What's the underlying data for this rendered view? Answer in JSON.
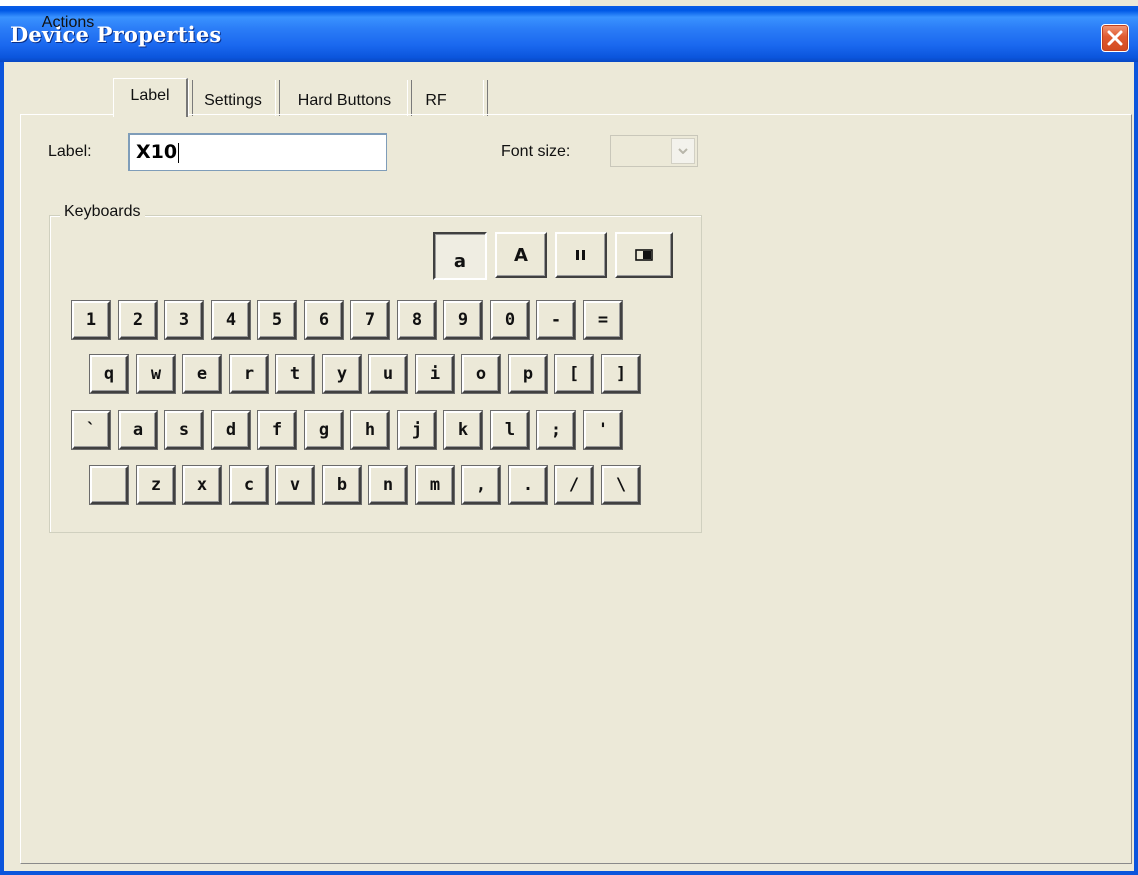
{
  "window": {
    "title": "Device Properties",
    "close_icon": "close-icon"
  },
  "tabs": [
    {
      "label": "Actions",
      "active": false
    },
    {
      "label": "Label",
      "active": true
    },
    {
      "label": "Settings",
      "active": false
    },
    {
      "label": "Hard Buttons",
      "active": false
    },
    {
      "label": "RF",
      "active": false
    }
  ],
  "label_field": {
    "label": "Label:",
    "value": "X10"
  },
  "font_size": {
    "label": "Font size:",
    "value": "",
    "arrow_icon": "chevron-down-icon"
  },
  "keyboards": {
    "title": "Keyboards",
    "modes": [
      {
        "label": "a",
        "name": "lowercase",
        "pressed": true
      },
      {
        "label": "A",
        "name": "uppercase",
        "pressed": false
      },
      {
        "label": "",
        "icon": "pause-icon",
        "name": "symbols",
        "pressed": false
      },
      {
        "label": "",
        "icon": "keypad-icon",
        "name": "special",
        "pressed": false
      }
    ],
    "rows": [
      [
        "1",
        "2",
        "3",
        "4",
        "5",
        "6",
        "7",
        "8",
        "9",
        "0",
        "-",
        "="
      ],
      [
        "q",
        "w",
        "e",
        "r",
        "t",
        "y",
        "u",
        "i",
        "o",
        "p",
        "[",
        "]"
      ],
      [
        "`",
        "a",
        "s",
        "d",
        "f",
        "g",
        "h",
        "j",
        "k",
        "l",
        ";",
        "'"
      ],
      [
        "",
        "z",
        "x",
        "c",
        "v",
        "b",
        "n",
        "m",
        ",",
        ".",
        "/",
        "\\"
      ]
    ]
  },
  "colors": {
    "titlebar": "#0058e6",
    "face": "#ece9d8",
    "close_button": "#e05a2f"
  }
}
